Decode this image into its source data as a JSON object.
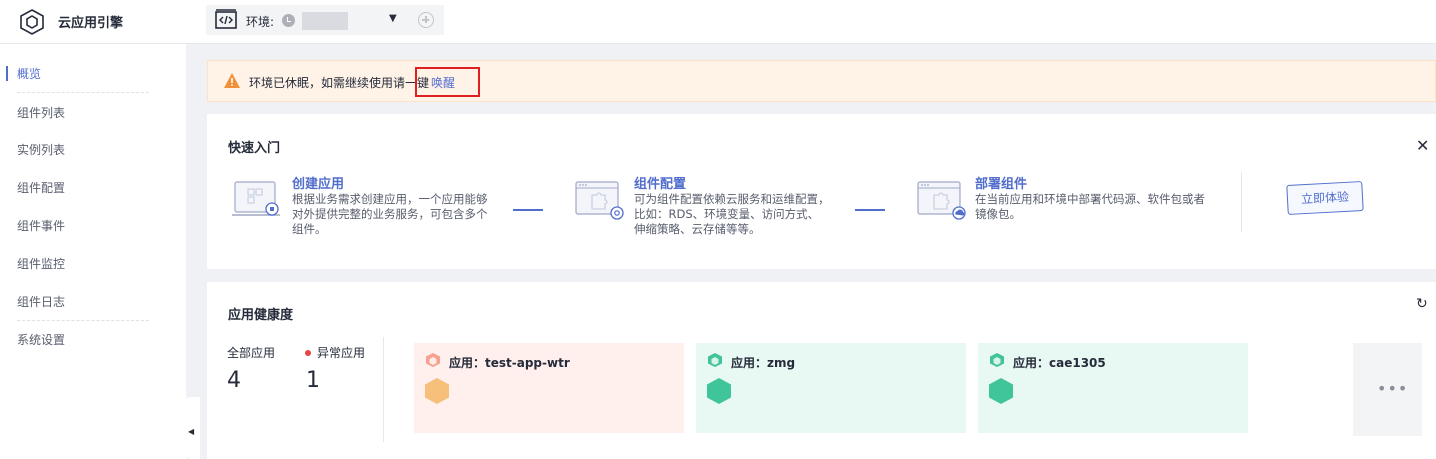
{
  "header": {
    "app_title": "云应用引擎",
    "env_label": "环境:"
  },
  "sidebar": {
    "items": [
      {
        "label": "概览",
        "active": true
      },
      {
        "label": "组件列表"
      },
      {
        "label": "实例列表"
      },
      {
        "label": "组件配置"
      },
      {
        "label": "组件事件"
      },
      {
        "label": "组件监控"
      },
      {
        "label": "组件日志"
      },
      {
        "label": "系统设置"
      }
    ]
  },
  "warning": {
    "text": "环境已休眠，如需继续使用请一键",
    "link": "唤醒"
  },
  "quick_start": {
    "title": "快速入门",
    "steps": [
      {
        "title": "创建应用",
        "desc": "根据业务需求创建应用，一个应用能够对外提供完整的业务服务，可包含多个组件。"
      },
      {
        "title": "组件配置",
        "desc": "可为组件配置依赖云服务和运维配置，比如：RDS、环境变量、访问方式、伸缩策略、云存储等等。"
      },
      {
        "title": "部署组件",
        "desc": "在当前应用和环境中部署代码源、软件包或者镜像包。"
      }
    ],
    "try_button": "立即体验"
  },
  "health": {
    "title": "应用健康度",
    "all_label": "全部应用",
    "all_count": "4",
    "abnormal_label": "异常应用",
    "abnormal_count": "1",
    "apps": [
      {
        "name": "应用：test-app-wtr",
        "status": "abnormal"
      },
      {
        "name": "应用：zmg",
        "status": "normal"
      },
      {
        "name": "应用：cae1305",
        "status": "normal"
      }
    ],
    "more": "•••"
  },
  "colors": {
    "accent": "#526ecc",
    "warning": "#f0913a",
    "abnormal": "#f7c07a",
    "normal": "#40c49a",
    "highlight_border": "#e02020"
  }
}
